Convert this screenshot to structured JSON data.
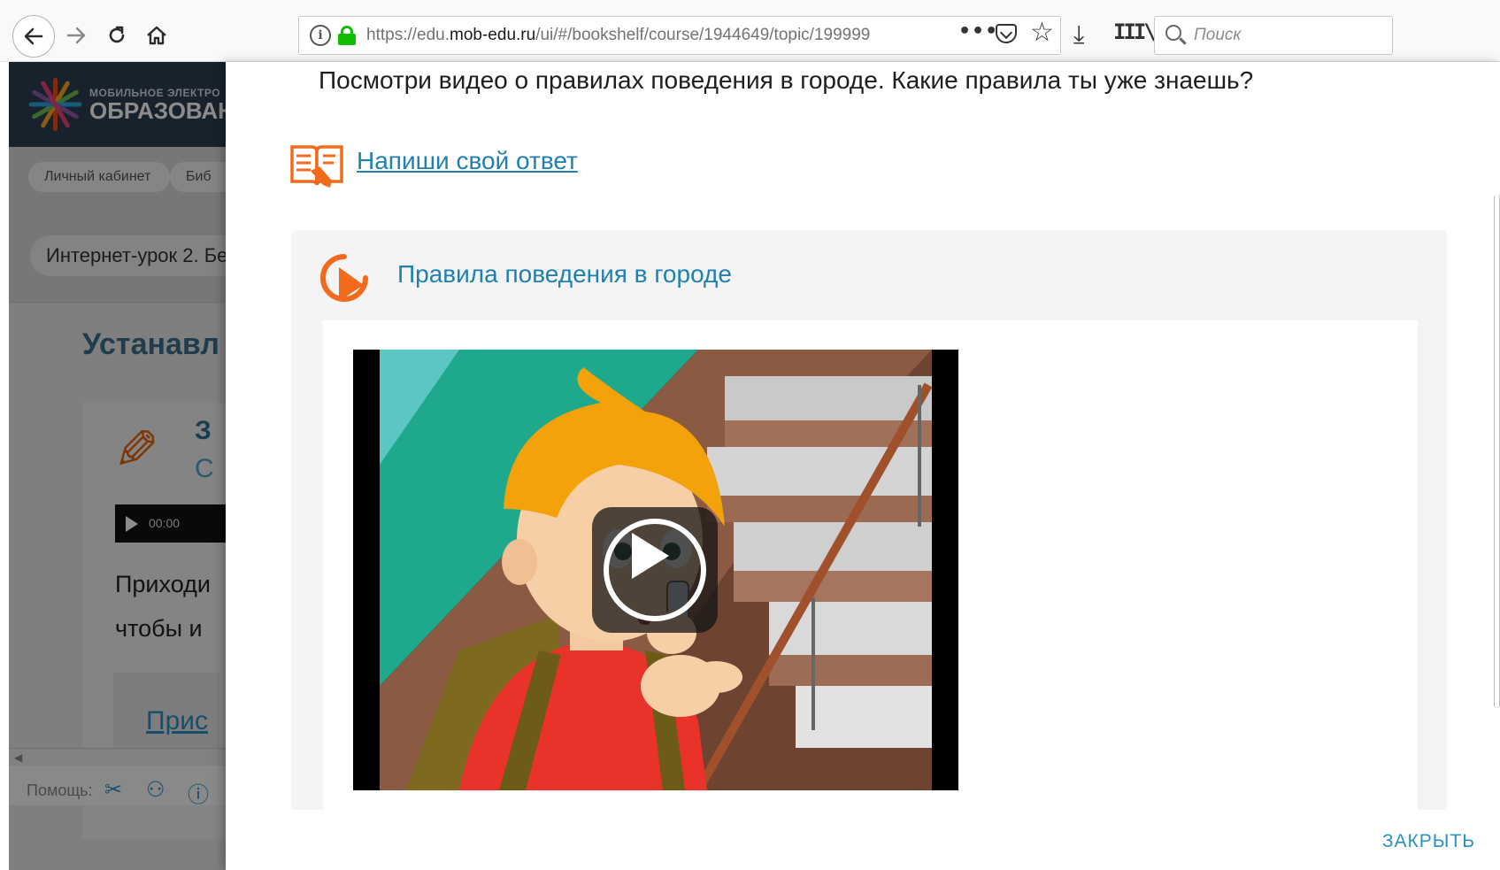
{
  "browser": {
    "url_prefix": "https://edu.",
    "url_domain": "mob-edu.ru",
    "url_path": "/ui/#/bookshelf/course/1944649/topic/199999",
    "search_placeholder": "Поиск",
    "more_label": "•••",
    "star_glyph": "☆",
    "download_glyph": "⤓",
    "library_glyph": "III\\"
  },
  "background_page": {
    "logo_line1": "МОБИЛЬНОЕ ЭЛЕКТРО",
    "logo_line2": "ОБРАЗОВАН",
    "breadcrumbs": [
      "Личный кабинет",
      "Биб"
    ],
    "lesson_name": "Интернет-урок 2. Бе",
    "section_title": "Устанавл",
    "card_title": "З",
    "card_subtitle": "С",
    "player_time": "00:00",
    "text_lines": [
      "Приходи",
      "чтобы и"
    ],
    "inner_link": "Прис",
    "help_label": "Помощь:"
  },
  "modal": {
    "task_text": "Посмотри видео о правилах поведения в городе. Какие правила ты уже знаешь?",
    "answer_link": "Напиши свой ответ",
    "video_title": "Правила поведения в городе",
    "close_label": "ЗАКРЫТЬ"
  },
  "colors": {
    "accent_orange": "#f26a1b",
    "link_blue": "#2080b0",
    "header_dark": "#2c3e50"
  },
  "icons": {
    "answer": "book-pencil-icon",
    "video": "video-play-icon",
    "play": "play-icon"
  }
}
